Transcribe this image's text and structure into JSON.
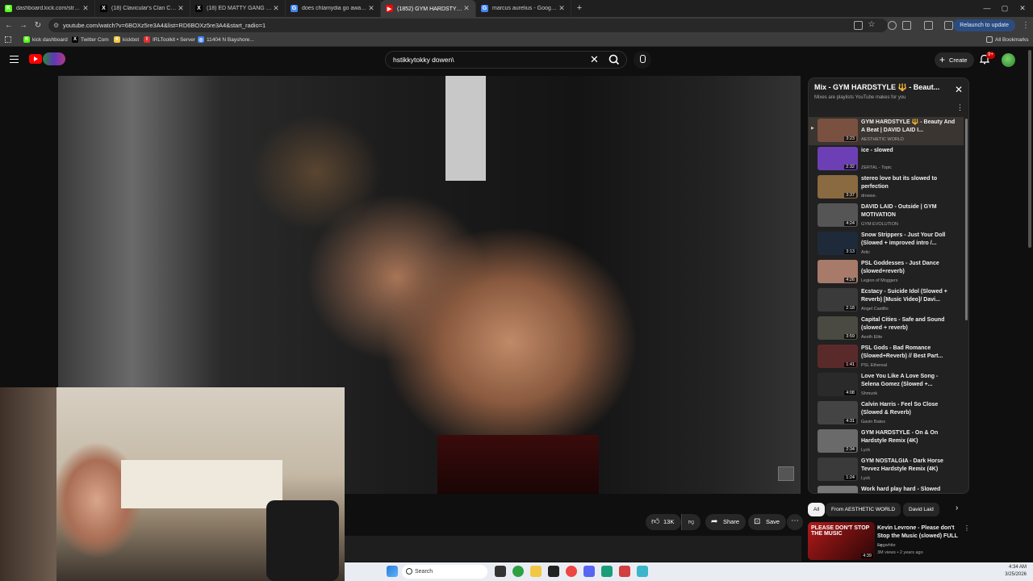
{
  "browser": {
    "tabs": [
      {
        "title": "dashboard.kick.com/stream",
        "favicon_color": "#53fc18",
        "favicon_glyph": "K",
        "active": false
      },
      {
        "title": "(18) Clavicular's Clan Commun",
        "favicon_color": "#000000",
        "favicon_glyph": "X",
        "active": false
      },
      {
        "title": "(18) ED MATTY GANG Commun",
        "favicon_color": "#000000",
        "favicon_glyph": "X",
        "active": false
      },
      {
        "title": "does chlamydia go away - Goo",
        "favicon_color": "#4285f4",
        "favicon_glyph": "G",
        "active": false
      },
      {
        "title": "(1852) GYM HARDSTYLE 🔱",
        "favicon_color": "#ff0000",
        "favicon_glyph": "▶",
        "active": true
      },
      {
        "title": "marcus aurelius - Google Sear",
        "favicon_color": "#4285f4",
        "favicon_glyph": "G",
        "active": false
      }
    ],
    "address": "youtube.com/watch?v=6BOXz5re3A4&list=RD6BOXz5re3A4&start_radio=1",
    "relaunch_label": "Relaunch to update",
    "bookmarks": [
      {
        "label": "kick dashboard",
        "color": "#53fc18",
        "glyph": "K"
      },
      {
        "label": "Twitter Com",
        "color": "#000000",
        "glyph": "X"
      },
      {
        "label": "kickbot",
        "color": "#f2c744",
        "glyph": "k"
      },
      {
        "label": "IRLToolkit • Server",
        "color": "#e03131",
        "glyph": "I"
      },
      {
        "label": "11404 N Bayshore...",
        "color": "#4285f4",
        "glyph": "◎"
      }
    ],
    "all_bookmarks_label": "All Bookmarks"
  },
  "youtube": {
    "search_query": "hstikkytokky dowen\\",
    "create_label": "Create",
    "notification_count": "9+",
    "actions": {
      "like_count": "13K",
      "share_label": "Share",
      "save_label": "Save"
    },
    "mix": {
      "title": "Mix - GYM HARDSTYLE 🔱 - Beaut...",
      "subtitle": "Mixes are playlists YouTube makes for you",
      "items": [
        {
          "title": "GYM HARDSTYLE 🔱 - Beauty And A Beat | DAVID LAID I...",
          "channel": "AESTHETIC WORLD",
          "duration": "3:23",
          "thumb": "#7a5040",
          "active": true
        },
        {
          "title": "ice - slowed",
          "channel": "ZERTAL - Topic",
          "duration": "2:32",
          "thumb": "#6d3fb5",
          "active": false
        },
        {
          "title": "stereo love but its slowed to perfection",
          "channel": "drowse.",
          "duration": "3:37",
          "thumb": "#8a6a40",
          "active": false
        },
        {
          "title": "DAVID LAID - Outside | GYM MOTIVATION",
          "channel": "GYM EVOLUTION",
          "duration": "4:24",
          "thumb": "#555555",
          "active": false
        },
        {
          "title": "Snow Strippers - Just Your Doll (Slowed + improved intro /...",
          "channel": "Artic",
          "duration": "3:13",
          "thumb": "#1e2a3a",
          "active": false
        },
        {
          "title": "PSL Goddesses - Just Dance (slowed+reverb)",
          "channel": "Legion of Moggers",
          "duration": "4:26",
          "thumb": "#a87a6a",
          "active": false
        },
        {
          "title": "Ecstacy - Suicide Idol (Slowed + Reverb) [Music Video]/ Davi...",
          "channel": "Angel Castillo",
          "duration": "2:18",
          "thumb": "#3a3a3a",
          "active": false
        },
        {
          "title": "Capital Cities - Safe and Sound (slowed + reverb)",
          "channel": "Aesth Elite",
          "duration": "3:59",
          "thumb": "#4a4a42",
          "active": false
        },
        {
          "title": "PSL Gods - Bad Romance (Slowed+Reverb) // Best Part...",
          "channel": "PSL Ethereal",
          "duration": "1:41",
          "thumb": "#5a2a2a",
          "active": false
        },
        {
          "title": "Love You Like A Love Song - Selena Gomez (Slowed +...",
          "channel": "Shmunk",
          "duration": "4:08",
          "thumb": "#2a2a2a",
          "active": false
        },
        {
          "title": "Calvin Harris - Feel So Close (Slowed & Reverb)",
          "channel": "Gavin Bates",
          "duration": "4:31",
          "thumb": "#444444",
          "active": false
        },
        {
          "title": "GYM HARDSTYLE - On & On Hardstyle Remix (4K)",
          "channel": "Lyck",
          "duration": "2:34",
          "thumb": "#6a6a6a",
          "active": false
        },
        {
          "title": "GYM NOSTALGIA - Dark Horse Tevvez Hardstyle Remix (4K)",
          "channel": "Lyck",
          "duration": "1:24",
          "thumb": "#3a3a3a",
          "active": false
        },
        {
          "title": "Work hard play hard - Slowed",
          "channel": "",
          "duration": "",
          "thumb": "#777777",
          "active": false
        }
      ]
    },
    "chips": [
      "All",
      "From AESTHETIC WORLD",
      "David Laid"
    ],
    "recommended": {
      "thumb_text": "PLEASE DON'T STOP THE MUSIC",
      "duration": "4:39",
      "title": "Kevin Levrone - Please don't Stop the Music (slowed) FULL ...",
      "channel": "Eggwhite",
      "meta": "3M views • 2 years ago"
    }
  },
  "taskbar": {
    "search_label": "Search",
    "time": "4:34 AM",
    "date": "3/25/2026"
  }
}
